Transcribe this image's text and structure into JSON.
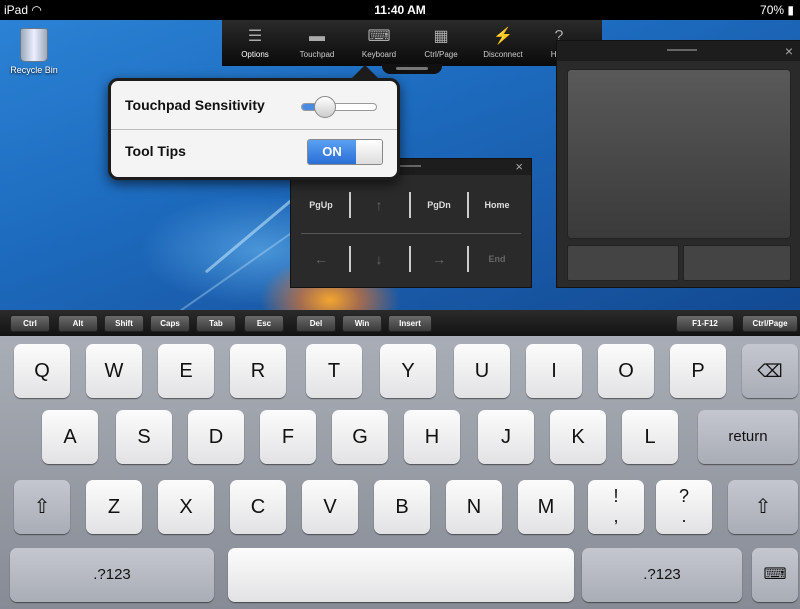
{
  "status_bar": {
    "device": "iPad",
    "wifi_icon": "wifi-icon",
    "time": "11:40 AM",
    "battery": "70%",
    "battery_icon": "battery-icon"
  },
  "desktop": {
    "recycle_bin_label": "Recycle Bin"
  },
  "toolbar": {
    "items": [
      {
        "label": "Options",
        "icon": "list-icon"
      },
      {
        "label": "Touchpad",
        "icon": "touchpad-icon"
      },
      {
        "label": "Keyboard",
        "icon": "keyboard-icon"
      },
      {
        "label": "Ctrl/Page",
        "icon": "ctrl-page-icon"
      },
      {
        "label": "Disconnect",
        "icon": "plug-icon"
      },
      {
        "label": "Help",
        "icon": "help-icon"
      }
    ]
  },
  "options_popup": {
    "touchpad_sensitivity_label": "Touchpad Sensitivity",
    "touchpad_sensitivity_value": 0.3,
    "tool_tips_label": "Tool Tips",
    "tool_tips_state": "ON"
  },
  "touchpad_panel": {
    "close": "×"
  },
  "ctrl_page_panel": {
    "close": "×",
    "keys": {
      "pgup": "PgUp",
      "up": "↑",
      "pgdn": "PgDn",
      "home": "Home",
      "left": "←",
      "down": "↓",
      "right": "→",
      "end": "End"
    }
  },
  "modifier_bar": {
    "keys": [
      "Ctrl",
      "Alt",
      "Shift",
      "Caps",
      "Tab",
      "Esc",
      "Del",
      "Win",
      "Insert"
    ],
    "right_keys": [
      "F1-F12",
      "Ctrl/Page"
    ]
  },
  "keyboard": {
    "row1": [
      "Q",
      "W",
      "E",
      "R",
      "T",
      "Y",
      "U",
      "I",
      "O",
      "P"
    ],
    "backspace_icon": "backspace-icon",
    "row2": [
      "A",
      "S",
      "D",
      "F",
      "G",
      "H",
      "J",
      "K",
      "L"
    ],
    "return_label": "return",
    "row3": [
      "Z",
      "X",
      "C",
      "V",
      "B",
      "N",
      "M"
    ],
    "exclaim_top": "!",
    "exclaim_bottom": ",",
    "question_top": "?",
    "question_bottom": ".",
    "shift_icon": "shift-icon",
    "numbers_label": ".?123",
    "hide_keyboard_icon": "hide-keyboard-icon"
  }
}
